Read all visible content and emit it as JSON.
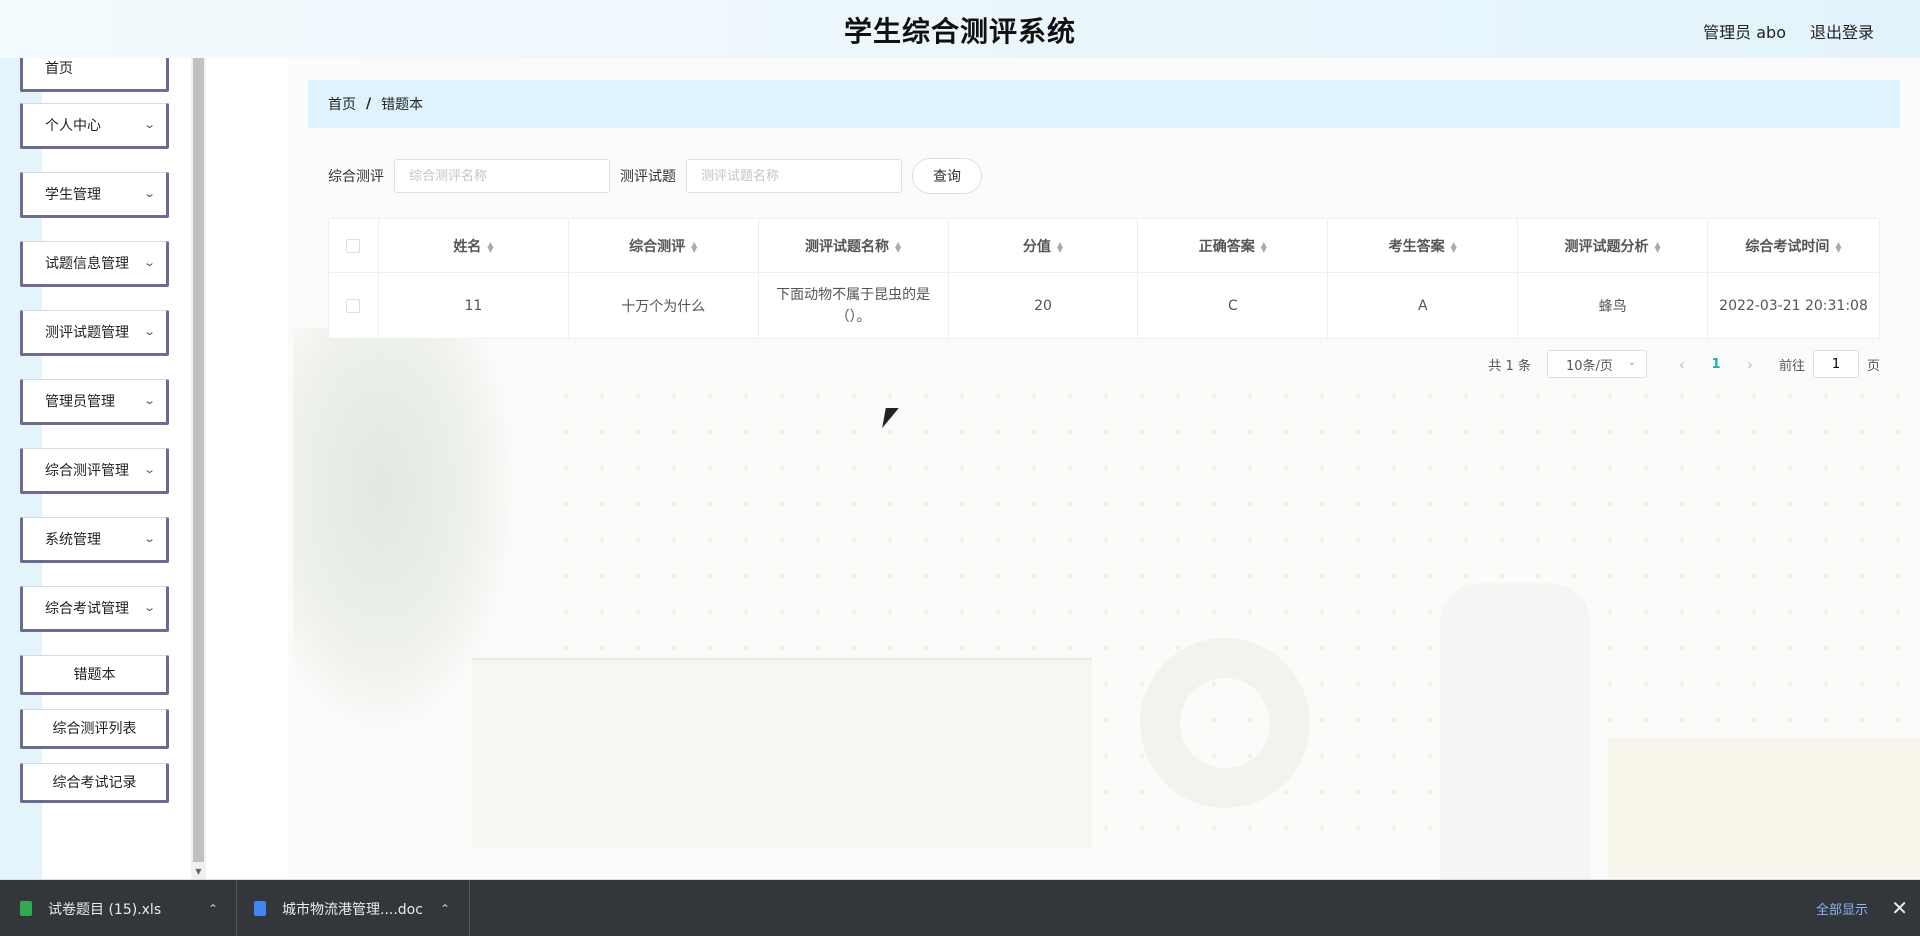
{
  "header": {
    "title": "学生综合测评系统",
    "user_label": "管理员 abo",
    "logout_label": "退出登录"
  },
  "sidebar": {
    "items": [
      {
        "label": "首页",
        "has_children": false
      },
      {
        "label": "个人中心",
        "has_children": true
      },
      {
        "label": "学生管理",
        "has_children": true
      },
      {
        "label": "试题信息管理",
        "has_children": true
      },
      {
        "label": "测评试题管理",
        "has_children": true
      },
      {
        "label": "管理员管理",
        "has_children": true
      },
      {
        "label": "综合测评管理",
        "has_children": true
      },
      {
        "label": "系统管理",
        "has_children": true
      },
      {
        "label": "综合考试管理",
        "has_children": true
      }
    ],
    "subitems": [
      {
        "label": "错题本"
      },
      {
        "label": "综合测评列表"
      },
      {
        "label": "综合考试记录"
      }
    ]
  },
  "breadcrumb": {
    "home": "首页",
    "separator": "/",
    "current": "错题本"
  },
  "search": {
    "field1_label": "综合测评",
    "field1_placeholder": "综合测评名称",
    "field2_label": "测评试题",
    "field2_placeholder": "测评试题名称",
    "button_label": "查询"
  },
  "table": {
    "columns": [
      "姓名",
      "综合测评",
      "测评试题名称",
      "分值",
      "正确答案",
      "考生答案",
      "测评试题分析",
      "综合考试时间"
    ],
    "rows": [
      [
        "11",
        "十万个为什么",
        "下面动物不属于昆虫的是（）。",
        "20",
        "C",
        "A",
        "蜂鸟",
        "2022-03-21 20:31:08"
      ]
    ]
  },
  "pagination": {
    "total": "共 1 条",
    "page_size": "10条/页",
    "current_page": "1",
    "goto_label": "前往",
    "goto_value": "1",
    "page_suffix": "页"
  },
  "downloads": {
    "items": [
      {
        "name": "试卷题目 (15).xls",
        "color": "#34a853"
      },
      {
        "name": "城市物流港管理....doc",
        "color": "#4285f4"
      }
    ],
    "show_all": "全部显示"
  },
  "colors": {
    "accent": "#17b3a3",
    "breadcrumb_bg": "#dff3fc",
    "menu_border": "#6e6a92"
  }
}
